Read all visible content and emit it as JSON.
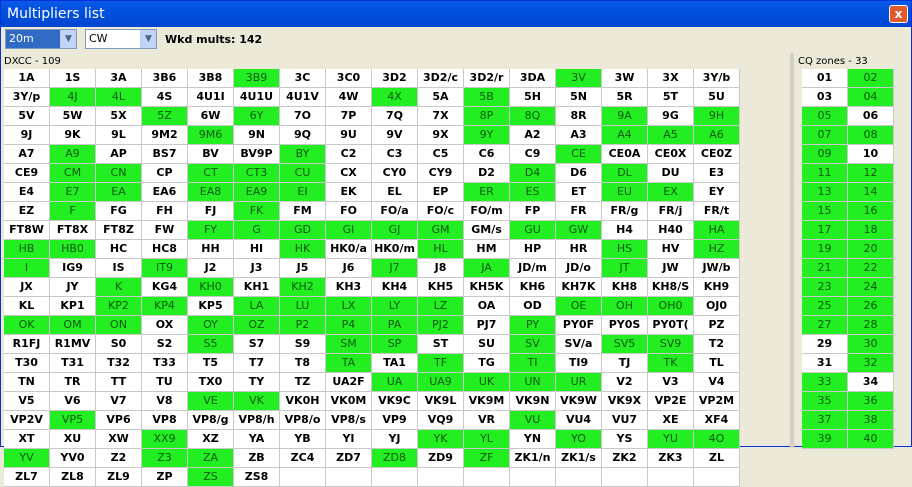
{
  "window": {
    "title": "Multipliers list",
    "close_label": "x"
  },
  "toolbar": {
    "band": "20m",
    "mode": "CW",
    "wkd_mults": "Wkd mults: 142"
  },
  "dxcc": {
    "label": "DXCC - 109",
    "cells": [
      [
        "1A",
        0
      ],
      [
        "1S",
        0
      ],
      [
        "3A",
        0
      ],
      [
        "3B6",
        0
      ],
      [
        "3B8",
        0
      ],
      [
        "3B9",
        1
      ],
      [
        "3C",
        0
      ],
      [
        "3C0",
        0
      ],
      [
        "3D2",
        0
      ],
      [
        "3D2/c",
        0
      ],
      [
        "3D2/r",
        0
      ],
      [
        "3DA",
        0
      ],
      [
        "3V",
        1
      ],
      [
        "3W",
        0
      ],
      [
        "3X",
        0
      ],
      [
        "3Y/b",
        0
      ],
      [
        "3Y/p",
        0
      ],
      [
        "4J",
        1
      ],
      [
        "4L",
        1
      ],
      [
        "4S",
        0
      ],
      [
        "4U1I",
        0
      ],
      [
        "4U1U",
        0
      ],
      [
        "4U1V",
        0
      ],
      [
        "4W",
        0
      ],
      [
        "4X",
        1
      ],
      [
        "5A",
        0
      ],
      [
        "5B",
        1
      ],
      [
        "5H",
        0
      ],
      [
        "5N",
        0
      ],
      [
        "5R",
        0
      ],
      [
        "5T",
        0
      ],
      [
        "5U",
        0
      ],
      [
        "5V",
        0
      ],
      [
        "5W",
        0
      ],
      [
        "5X",
        0
      ],
      [
        "5Z",
        1
      ],
      [
        "6W",
        0
      ],
      [
        "6Y",
        1
      ],
      [
        "7O",
        0
      ],
      [
        "7P",
        0
      ],
      [
        "7Q",
        0
      ],
      [
        "7X",
        0
      ],
      [
        "8P",
        1
      ],
      [
        "8Q",
        1
      ],
      [
        "8R",
        0
      ],
      [
        "9A",
        1
      ],
      [
        "9G",
        0
      ],
      [
        "9H",
        1
      ],
      [
        "9J",
        0
      ],
      [
        "9K",
        0
      ],
      [
        "9L",
        0
      ],
      [
        "9M2",
        0
      ],
      [
        "9M6",
        1
      ],
      [
        "9N",
        0
      ],
      [
        "9Q",
        0
      ],
      [
        "9U",
        0
      ],
      [
        "9V",
        0
      ],
      [
        "9X",
        0
      ],
      [
        "9Y",
        1
      ],
      [
        "A2",
        0
      ],
      [
        "A3",
        0
      ],
      [
        "A4",
        1
      ],
      [
        "A5",
        1
      ],
      [
        "A6",
        1
      ],
      [
        "A7",
        0
      ],
      [
        "A9",
        1
      ],
      [
        "AP",
        0
      ],
      [
        "BS7",
        0
      ],
      [
        "BV",
        0
      ],
      [
        "BV9P",
        0
      ],
      [
        "BY",
        1
      ],
      [
        "C2",
        0
      ],
      [
        "C3",
        0
      ],
      [
        "C5",
        0
      ],
      [
        "C6",
        0
      ],
      [
        "C9",
        0
      ],
      [
        "CE",
        1
      ],
      [
        "CE0A",
        0
      ],
      [
        "CE0X",
        0
      ],
      [
        "CE0Z",
        0
      ],
      [
        "CE9",
        0
      ],
      [
        "CM",
        1
      ],
      [
        "CN",
        1
      ],
      [
        "CP",
        0
      ],
      [
        "CT",
        1
      ],
      [
        "CT3",
        1
      ],
      [
        "CU",
        1
      ],
      [
        "CX",
        0
      ],
      [
        "CY0",
        0
      ],
      [
        "CY9",
        0
      ],
      [
        "D2",
        0
      ],
      [
        "D4",
        1
      ],
      [
        "D6",
        0
      ],
      [
        "DL",
        1
      ],
      [
        "DU",
        0
      ],
      [
        "E3",
        0
      ],
      [
        "E4",
        0
      ],
      [
        "E7",
        1
      ],
      [
        "EA",
        1
      ],
      [
        "EA6",
        0
      ],
      [
        "EA8",
        1
      ],
      [
        "EA9",
        1
      ],
      [
        "EI",
        1
      ],
      [
        "EK",
        0
      ],
      [
        "EL",
        0
      ],
      [
        "EP",
        0
      ],
      [
        "ER",
        1
      ],
      [
        "ES",
        1
      ],
      [
        "ET",
        0
      ],
      [
        "EU",
        1
      ],
      [
        "EX",
        1
      ],
      [
        "EY",
        0
      ],
      [
        "EZ",
        0
      ],
      [
        "F",
        1
      ],
      [
        "FG",
        0
      ],
      [
        "FH",
        0
      ],
      [
        "FJ",
        0
      ],
      [
        "FK",
        1
      ],
      [
        "FM",
        0
      ],
      [
        "FO",
        0
      ],
      [
        "FO/a",
        0
      ],
      [
        "FO/c",
        0
      ],
      [
        "FO/m",
        0
      ],
      [
        "FP",
        0
      ],
      [
        "FR",
        0
      ],
      [
        "FR/g",
        0
      ],
      [
        "FR/j",
        0
      ],
      [
        "FR/t",
        0
      ],
      [
        "FT8W",
        0
      ],
      [
        "FT8X",
        0
      ],
      [
        "FT8Z",
        0
      ],
      [
        "FW",
        0
      ],
      [
        "FY",
        1
      ],
      [
        "G",
        1
      ],
      [
        "GD",
        1
      ],
      [
        "GI",
        1
      ],
      [
        "GJ",
        1
      ],
      [
        "GM",
        1
      ],
      [
        "GM/s",
        0
      ],
      [
        "GU",
        1
      ],
      [
        "GW",
        1
      ],
      [
        "H4",
        0
      ],
      [
        "H40",
        0
      ],
      [
        "HA",
        1
      ],
      [
        "HB",
        1
      ],
      [
        "HB0",
        1
      ],
      [
        "HC",
        0
      ],
      [
        "HC8",
        0
      ],
      [
        "HH",
        0
      ],
      [
        "HI",
        0
      ],
      [
        "HK",
        1
      ],
      [
        "HK0/a",
        0
      ],
      [
        "HK0/m",
        0
      ],
      [
        "HL",
        1
      ],
      [
        "HM",
        0
      ],
      [
        "HP",
        0
      ],
      [
        "HR",
        0
      ],
      [
        "HS",
        1
      ],
      [
        "HV",
        0
      ],
      [
        "HZ",
        1
      ],
      [
        "I",
        1
      ],
      [
        "IG9",
        0
      ],
      [
        "IS",
        0
      ],
      [
        "IT9",
        1
      ],
      [
        "J2",
        0
      ],
      [
        "J3",
        0
      ],
      [
        "J5",
        0
      ],
      [
        "J6",
        0
      ],
      [
        "J7",
        1
      ],
      [
        "J8",
        0
      ],
      [
        "JA",
        1
      ],
      [
        "JD/m",
        0
      ],
      [
        "JD/o",
        0
      ],
      [
        "JT",
        1
      ],
      [
        "JW",
        0
      ],
      [
        "JW/b",
        0
      ],
      [
        "JX",
        0
      ],
      [
        "JY",
        0
      ],
      [
        "K",
        1
      ],
      [
        "KG4",
        0
      ],
      [
        "KH0",
        1
      ],
      [
        "KH1",
        0
      ],
      [
        "KH2",
        1
      ],
      [
        "KH3",
        0
      ],
      [
        "KH4",
        0
      ],
      [
        "KH5",
        0
      ],
      [
        "KH5K",
        0
      ],
      [
        "KH6",
        0
      ],
      [
        "KH7K",
        0
      ],
      [
        "KH8",
        0
      ],
      [
        "KH8/S",
        0
      ],
      [
        "KH9",
        0
      ],
      [
        "KL",
        0
      ],
      [
        "KP1",
        0
      ],
      [
        "KP2",
        1
      ],
      [
        "KP4",
        1
      ],
      [
        "KP5",
        0
      ],
      [
        "LA",
        1
      ],
      [
        "LU",
        1
      ],
      [
        "LX",
        1
      ],
      [
        "LY",
        1
      ],
      [
        "LZ",
        1
      ],
      [
        "OA",
        0
      ],
      [
        "OD",
        0
      ],
      [
        "OE",
        1
      ],
      [
        "OH",
        1
      ],
      [
        "OH0",
        1
      ],
      [
        "OJ0",
        0
      ],
      [
        "OK",
        1
      ],
      [
        "OM",
        1
      ],
      [
        "ON",
        1
      ],
      [
        "OX",
        0
      ],
      [
        "OY",
        1
      ],
      [
        "OZ",
        1
      ],
      [
        "P2",
        1
      ],
      [
        "P4",
        1
      ],
      [
        "PA",
        1
      ],
      [
        "PJ2",
        1
      ],
      [
        "PJ7",
        0
      ],
      [
        "PY",
        1
      ],
      [
        "PY0F",
        0
      ],
      [
        "PY0S",
        0
      ],
      [
        "PY0T(",
        0
      ],
      [
        "PZ",
        0
      ],
      [
        "R1FJ",
        0
      ],
      [
        "R1MV",
        0
      ],
      [
        "S0",
        0
      ],
      [
        "S2",
        0
      ],
      [
        "S5",
        1
      ],
      [
        "S7",
        0
      ],
      [
        "S9",
        0
      ],
      [
        "SM",
        1
      ],
      [
        "SP",
        1
      ],
      [
        "ST",
        0
      ],
      [
        "SU",
        0
      ],
      [
        "SV",
        1
      ],
      [
        "SV/a",
        0
      ],
      [
        "SV5",
        1
      ],
      [
        "SV9",
        1
      ],
      [
        "T2",
        0
      ],
      [
        "T30",
        0
      ],
      [
        "T31",
        0
      ],
      [
        "T32",
        0
      ],
      [
        "T33",
        0
      ],
      [
        "T5",
        0
      ],
      [
        "T7",
        0
      ],
      [
        "T8",
        0
      ],
      [
        "TA",
        1
      ],
      [
        "TA1",
        0
      ],
      [
        "TF",
        1
      ],
      [
        "TG",
        0
      ],
      [
        "TI",
        1
      ],
      [
        "TI9",
        0
      ],
      [
        "TJ",
        0
      ],
      [
        "TK",
        1
      ],
      [
        "TL",
        0
      ],
      [
        "TN",
        0
      ],
      [
        "TR",
        0
      ],
      [
        "TT",
        0
      ],
      [
        "TU",
        0
      ],
      [
        "TX0",
        0
      ],
      [
        "TY",
        0
      ],
      [
        "TZ",
        0
      ],
      [
        "UA2F",
        0
      ],
      [
        "UA",
        1
      ],
      [
        "UA9",
        1
      ],
      [
        "UK",
        1
      ],
      [
        "UN",
        1
      ],
      [
        "UR",
        1
      ],
      [
        "V2",
        0
      ],
      [
        "V3",
        0
      ],
      [
        "V4",
        0
      ],
      [
        "V5",
        0
      ],
      [
        "V6",
        0
      ],
      [
        "V7",
        0
      ],
      [
        "V8",
        0
      ],
      [
        "VE",
        1
      ],
      [
        "VK",
        1
      ],
      [
        "VK0H",
        0
      ],
      [
        "VK0M",
        0
      ],
      [
        "VK9C",
        0
      ],
      [
        "VK9L",
        0
      ],
      [
        "VK9M",
        0
      ],
      [
        "VK9N",
        0
      ],
      [
        "VK9W",
        0
      ],
      [
        "VK9X",
        0
      ],
      [
        "VP2E",
        0
      ],
      [
        "VP2M",
        0
      ],
      [
        "VP2V",
        0
      ],
      [
        "VP5",
        1
      ],
      [
        "VP6",
        0
      ],
      [
        "VP8",
        0
      ],
      [
        "VP8/g",
        0
      ],
      [
        "VP8/h",
        0
      ],
      [
        "VP8/o",
        0
      ],
      [
        "VP8/s",
        0
      ],
      [
        "VP9",
        0
      ],
      [
        "VQ9",
        0
      ],
      [
        "VR",
        0
      ],
      [
        "VU",
        1
      ],
      [
        "VU4",
        0
      ],
      [
        "VU7",
        0
      ],
      [
        "XE",
        0
      ],
      [
        "XF4",
        0
      ],
      [
        "XT",
        0
      ],
      [
        "XU",
        0
      ],
      [
        "XW",
        0
      ],
      [
        "XX9",
        1
      ],
      [
        "XZ",
        0
      ],
      [
        "YA",
        0
      ],
      [
        "YB",
        0
      ],
      [
        "YI",
        0
      ],
      [
        "YJ",
        0
      ],
      [
        "YK",
        1
      ],
      [
        "YL",
        1
      ],
      [
        "YN",
        0
      ],
      [
        "YO",
        1
      ],
      [
        "YS",
        0
      ],
      [
        "YU",
        1
      ],
      [
        "4O",
        1
      ],
      [
        "YV",
        1
      ],
      [
        "YV0",
        0
      ],
      [
        "Z2",
        0
      ],
      [
        "Z3",
        1
      ],
      [
        "ZA",
        1
      ],
      [
        "ZB",
        0
      ],
      [
        "ZC4",
        0
      ],
      [
        "ZD7",
        0
      ],
      [
        "ZD8",
        1
      ],
      [
        "ZD9",
        0
      ],
      [
        "ZF",
        1
      ],
      [
        "ZK1/n",
        0
      ],
      [
        "ZK1/s",
        0
      ],
      [
        "ZK2",
        0
      ],
      [
        "ZK3",
        0
      ],
      [
        "ZL",
        0
      ],
      [
        "ZL7",
        0
      ],
      [
        "ZL8",
        0
      ],
      [
        "ZL9",
        0
      ],
      [
        "ZP",
        0
      ],
      [
        "ZS",
        1
      ],
      [
        "ZS8",
        0
      ],
      [
        "",
        0
      ],
      [
        "",
        0
      ],
      [
        "",
        0
      ],
      [
        "",
        0
      ],
      [
        "",
        0
      ],
      [
        "",
        0
      ],
      [
        "",
        0
      ],
      [
        "",
        0
      ],
      [
        "",
        0
      ],
      [
        "",
        0
      ]
    ]
  },
  "cq": {
    "label": "CQ zones - 33",
    "cells": [
      [
        "01",
        0
      ],
      [
        "02",
        1
      ],
      [
        "03",
        0
      ],
      [
        "04",
        1
      ],
      [
        "05",
        1
      ],
      [
        "06",
        0
      ],
      [
        "07",
        1
      ],
      [
        "08",
        1
      ],
      [
        "09",
        1
      ],
      [
        "10",
        0
      ],
      [
        "11",
        1
      ],
      [
        "12",
        1
      ],
      [
        "13",
        1
      ],
      [
        "14",
        1
      ],
      [
        "15",
        1
      ],
      [
        "16",
        1
      ],
      [
        "17",
        1
      ],
      [
        "18",
        1
      ],
      [
        "19",
        1
      ],
      [
        "20",
        1
      ],
      [
        "21",
        1
      ],
      [
        "22",
        1
      ],
      [
        "23",
        1
      ],
      [
        "24",
        1
      ],
      [
        "25",
        1
      ],
      [
        "26",
        1
      ],
      [
        "27",
        1
      ],
      [
        "28",
        1
      ],
      [
        "29",
        0
      ],
      [
        "30",
        1
      ],
      [
        "31",
        0
      ],
      [
        "32",
        1
      ],
      [
        "33",
        1
      ],
      [
        "34",
        0
      ],
      [
        "35",
        1
      ],
      [
        "36",
        1
      ],
      [
        "37",
        1
      ],
      [
        "38",
        1
      ],
      [
        "39",
        1
      ],
      [
        "40",
        1
      ]
    ]
  },
  "colors": {
    "worked": "#22ee22",
    "unworked": "#ffffff"
  }
}
